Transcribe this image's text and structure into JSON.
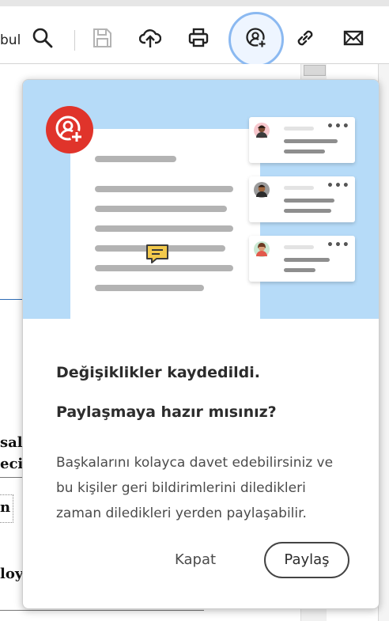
{
  "toolbar": {
    "find_partial_label": "bul",
    "icons": [
      "search-icon",
      "save-icon",
      "upload-icon",
      "print-icon",
      "share-user-add-icon",
      "link-icon",
      "mail-icon"
    ]
  },
  "document": {
    "fragments": [
      "sal",
      "eci",
      "n",
      "loy"
    ]
  },
  "popover": {
    "title": "Değişiklikler kaydedildi.",
    "subtitle": "Paylaşmaya hazır mısınız?",
    "body": "Başkalarını kolayca davet edebilirsiniz ve bu kişiler geri bildirimlerini diledikleri zaman diledikleri yerden paylaşabilir.",
    "close_label": "Kapat",
    "share_label": "Paylaş",
    "illustration": {
      "background": "#b6dbf8",
      "badge_color": "#e0342b",
      "comment_icon_color": "#f2c94c",
      "card_count": 3,
      "card_dots": "•••"
    }
  }
}
